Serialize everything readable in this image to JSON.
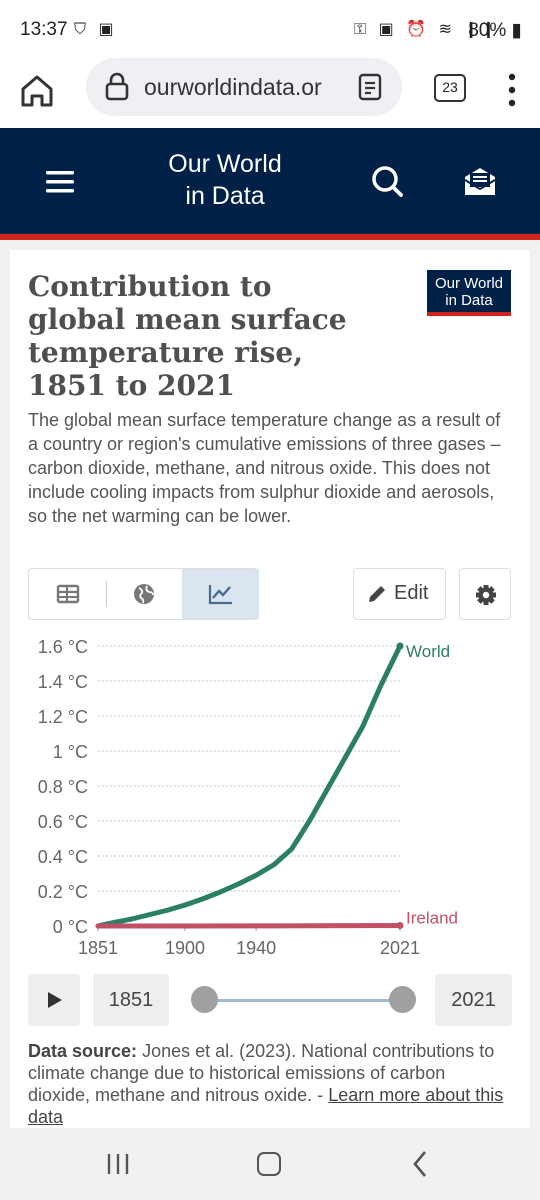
{
  "status_bar": {
    "time": "13:37",
    "left_icons": "⛉ ▣",
    "right_icons": "⚿ ▣ ⏰ ≋ ❙❙",
    "battery": "80%"
  },
  "browser": {
    "url": "ourworldindata.or",
    "tab_count": "23",
    "icons": [
      "home-icon",
      "lock-icon",
      "reader-mode-icon",
      "tabs-icon",
      "more-vert-icon"
    ]
  },
  "site_header": {
    "brand_line1": "Our World",
    "brand_line2": "in Data",
    "icons": [
      "hamburger-menu-icon",
      "search-icon",
      "newsletter-icon"
    ],
    "bg_color": "#002147",
    "accent_color": "#ce261e"
  },
  "card": {
    "title": "Contribution to global mean surface temperature rise, 1851 to 2021",
    "logo_line1": "Our World",
    "logo_line2": "in Data",
    "subtitle": "The global mean surface temperature change as a result of a country or region's cumulative emissions of three gases – carbon dioxide, methane, and nitrous oxide. This does not include cooling impacts from sulphur dioxide and aerosols, so the net warming can be lower.",
    "tabs": [
      {
        "name": "table",
        "icon": "table-icon",
        "active": false
      },
      {
        "name": "map",
        "icon": "globe-icon",
        "active": false
      },
      {
        "name": "chart",
        "icon": "line-chart-icon",
        "active": true
      }
    ],
    "edit_label": "Edit",
    "settings_icon": "gear-icon"
  },
  "chart_data": {
    "type": "line",
    "title": "",
    "xlabel": "",
    "ylabel": "",
    "ylim": [
      0,
      1.6
    ],
    "xlim": [
      1851,
      2021
    ],
    "y_ticks": [
      "0 °C",
      "0.2 °C",
      "0.4 °C",
      "0.6 °C",
      "0.8 °C",
      "1 °C",
      "1.2 °C",
      "1.4 °C",
      "1.6 °C"
    ],
    "y_tick_values": [
      0,
      0.2,
      0.4,
      0.6,
      0.8,
      1.0,
      1.2,
      1.4,
      1.6
    ],
    "x_ticks": [
      "1851",
      "1900",
      "1940",
      "2021"
    ],
    "x_tick_values": [
      1851,
      1900,
      1940,
      2021
    ],
    "grid": "horizontal dotted",
    "series": [
      {
        "name": "World",
        "color": "#2a8060",
        "x": [
          1851,
          1860,
          1870,
          1880,
          1890,
          1900,
          1910,
          1920,
          1930,
          1940,
          1950,
          1960,
          1970,
          1980,
          1990,
          2000,
          2010,
          2021
        ],
        "values": [
          0.0,
          0.02,
          0.04,
          0.065,
          0.09,
          0.12,
          0.155,
          0.195,
          0.24,
          0.29,
          0.35,
          0.44,
          0.6,
          0.78,
          0.96,
          1.14,
          1.37,
          1.6
        ]
      },
      {
        "name": "Ireland",
        "color": "#c15065",
        "x": [
          1851,
          1900,
          1950,
          2000,
          2021
        ],
        "values": [
          0.0,
          0.0,
          0.001,
          0.002,
          0.003
        ]
      }
    ]
  },
  "timeline": {
    "start_year": "1851",
    "end_year": "2021",
    "range_start_fraction": 0,
    "range_end_fraction": 1,
    "play_icon": "play-icon"
  },
  "source": {
    "label": "Data source:",
    "text": "Jones et al. (2023). National contributions to climate change due to historical emissions of carbon dioxide, methane and nitrous oxide. -",
    "link": "Learn more about this data"
  },
  "nav_bar": {
    "icons": [
      "recent-apps-icon",
      "home-nav-icon",
      "back-icon"
    ]
  }
}
